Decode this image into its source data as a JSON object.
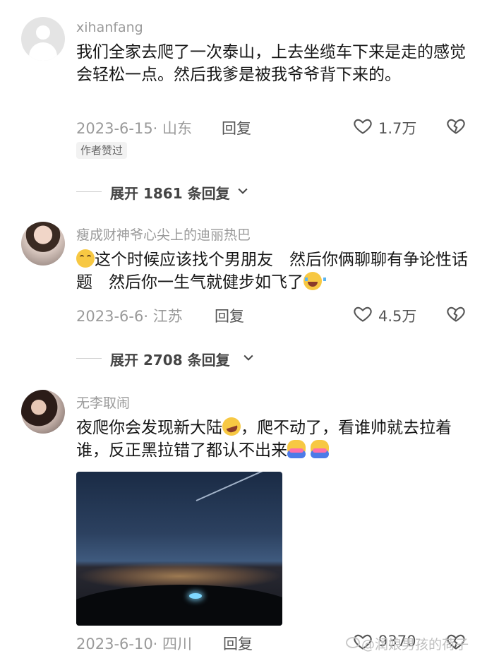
{
  "comments": [
    {
      "username": "xihanfang",
      "text": "我们全家去爬了一次泰山，上去坐缆车下来是走的感觉会轻松一点。然后我爹是被我爷爷背下来的。",
      "date": "2023-6-15· 山东",
      "reply": "回复",
      "likes": "1.7万",
      "author_badge": "作者赞过",
      "expand_label": "展开 1861 条回复"
    },
    {
      "username": "瘦成财神爷心尖上的迪丽热巴",
      "text_before_emoji": "这个时候应该找个男朋友　然后你俩聊聊有争论性话题　然后你一生气就健步如飞了",
      "date": "2023-6-6· 江苏",
      "reply": "回复",
      "likes": "4.5万",
      "expand_label": "展开 2708 条回复"
    },
    {
      "username": "无李取闹",
      "text_part1": "夜爬你会发现新大陆",
      "text_part2": "，爬不动了，看谁帅就去拉着谁，反正黑拉错了都认不出来",
      "date": "2023-6-10· 四川",
      "reply": "回复",
      "likes": "9370"
    }
  ],
  "watermark": "@润娘男孩的荷子",
  "icons": {
    "like": "heart-outline-icon",
    "dislike": "broken-heart-icon",
    "expand": "chevron-down-icon"
  },
  "colors": {
    "text": "#161616",
    "meta": "#9a9a9a"
  }
}
